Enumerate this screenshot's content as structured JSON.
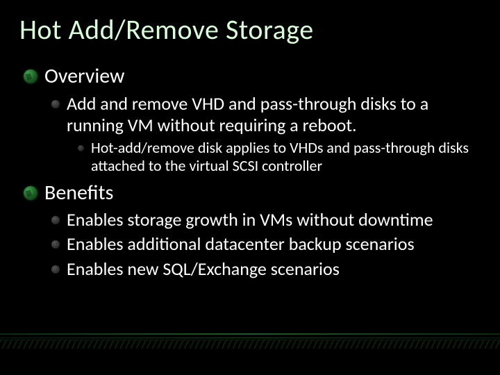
{
  "title": "Hot Add/Remove Storage",
  "sections": [
    {
      "heading": "Overview",
      "items": [
        {
          "text": "Add and remove VHD and pass-through disks to a running VM without requiring a reboot.",
          "sub": [
            "Hot-add/remove disk applies to VHDs and pass-through disks attached to the virtual SCSI controller"
          ]
        }
      ]
    },
    {
      "heading": "Benefits",
      "items": [
        {
          "text": "Enables storage growth in VMs without downtime"
        },
        {
          "text": "Enables additional datacenter backup scenarios"
        },
        {
          "text": "Enables new SQL/Exchange scenarios"
        }
      ]
    }
  ]
}
